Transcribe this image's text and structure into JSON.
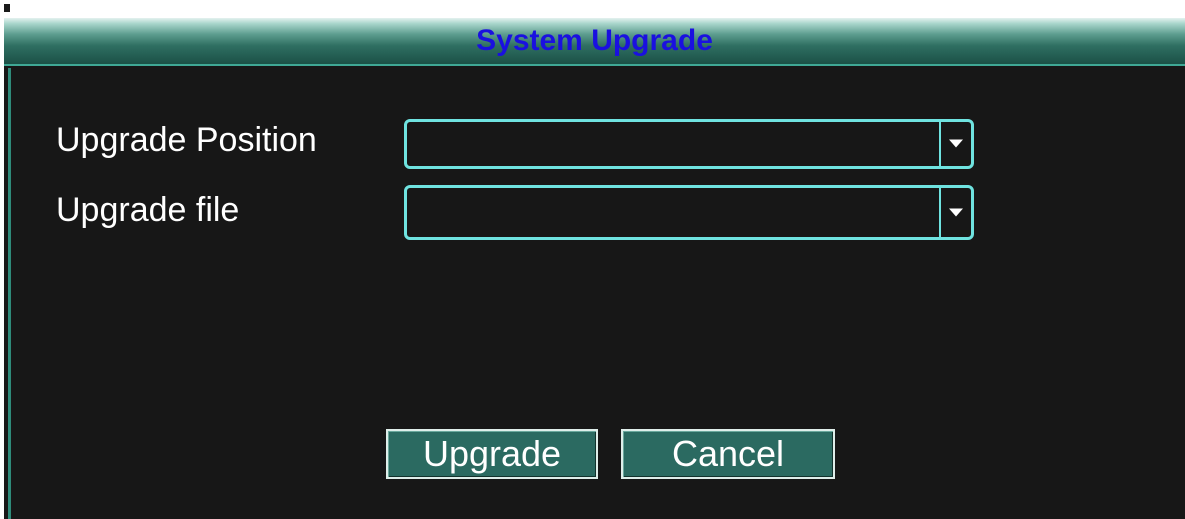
{
  "dialog": {
    "title": "System Upgrade",
    "title_color": "#1a10e0",
    "accent_color": "#6fe3e0",
    "background_color": "#171717"
  },
  "fields": {
    "position": {
      "label": "Upgrade Position",
      "value": "",
      "icon": "chevron-down-icon"
    },
    "file": {
      "label": "Upgrade file",
      "value": "",
      "icon": "chevron-down-icon"
    }
  },
  "buttons": {
    "upgrade_label": "Upgrade",
    "cancel_label": "Cancel"
  }
}
